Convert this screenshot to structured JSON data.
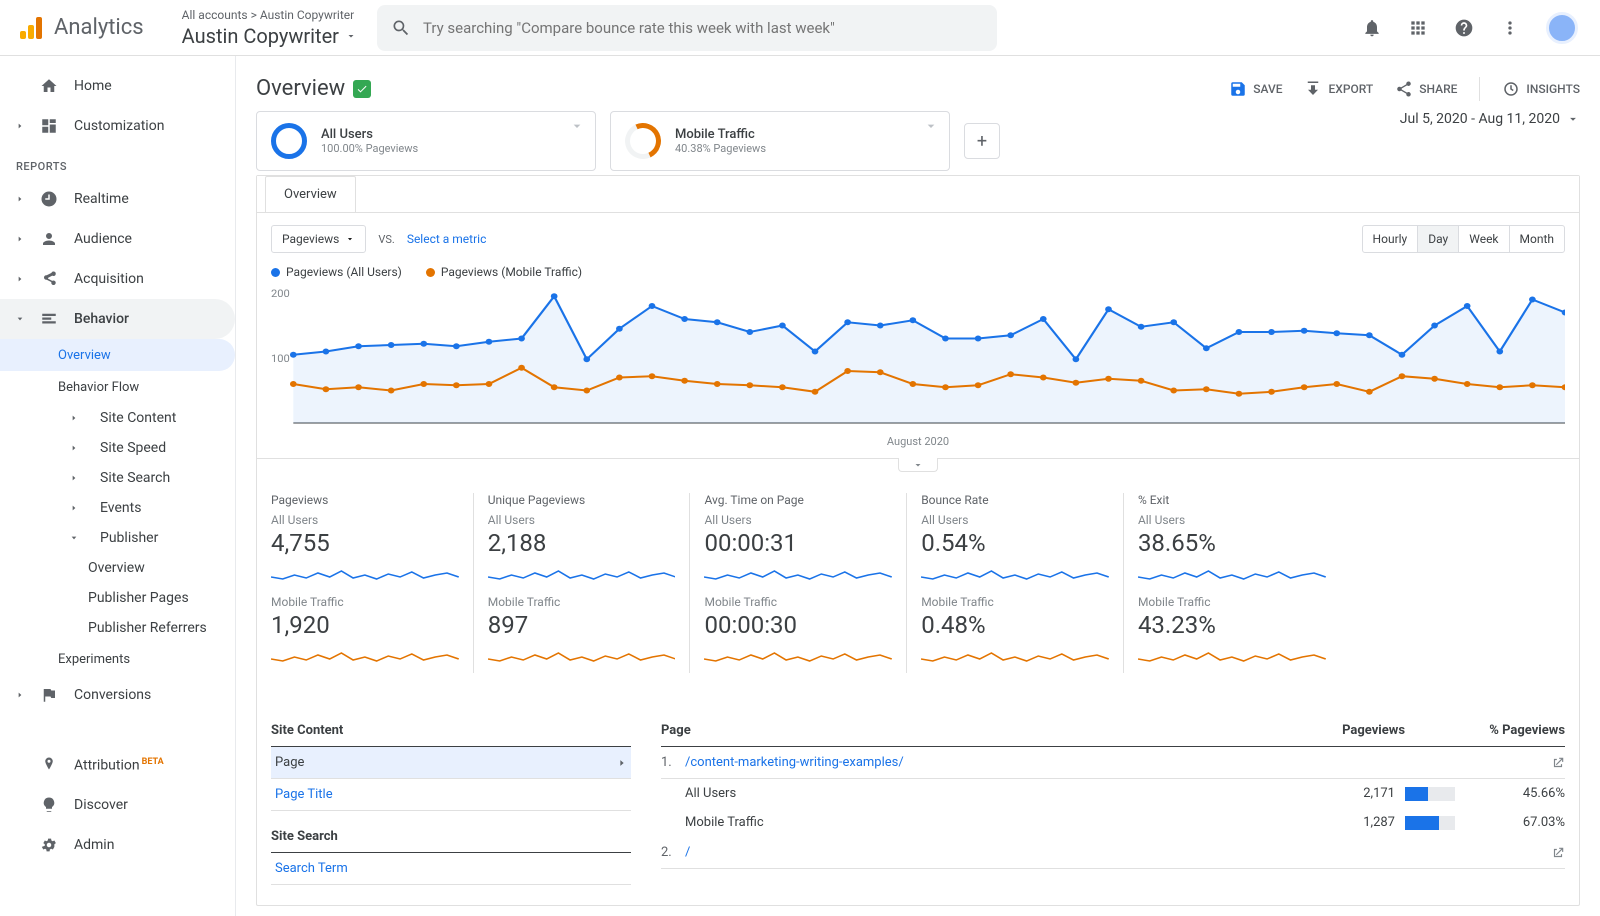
{
  "appbar": {
    "logo_text": "Analytics",
    "breadcrumb_top": "All accounts > Austin Copywriter",
    "breadcrumb_main": "Austin Copywriter",
    "search_placeholder": "Try searching \"Compare bounce rate this week with last week\""
  },
  "sidebar": {
    "home": "Home",
    "customization": "Customization",
    "reports_heading": "REPORTS",
    "realtime": "Realtime",
    "audience": "Audience",
    "acquisition": "Acquisition",
    "behavior": "Behavior",
    "b_overview": "Overview",
    "b_flow": "Behavior Flow",
    "b_sitecontent": "Site Content",
    "b_sitespeed": "Site Speed",
    "b_sitesearch": "Site Search",
    "b_events": "Events",
    "b_publisher": "Publisher",
    "b_pub_overview": "Overview",
    "b_pub_pages": "Publisher Pages",
    "b_pub_refs": "Publisher Referrers",
    "b_experiments": "Experiments",
    "conversions": "Conversions",
    "attribution": "Attribution",
    "beta": "BETA",
    "discover": "Discover",
    "admin": "Admin"
  },
  "page": {
    "title": "Overview",
    "save": "SAVE",
    "export": "EXPORT",
    "share": "SHARE",
    "insights": "INSIGHTS",
    "date_range": "Jul 5, 2020 - Aug 11, 2020"
  },
  "segments": {
    "a": {
      "title": "All Users",
      "sub": "100.00% Pageviews"
    },
    "b": {
      "title": "Mobile Traffic",
      "sub": "40.38% Pageviews"
    }
  },
  "tabs": {
    "overview": "Overview"
  },
  "chartbar": {
    "metric": "Pageviews",
    "vs": "VS.",
    "select_metric": "Select a metric",
    "hourly": "Hourly",
    "day": "Day",
    "week": "Week",
    "month": "Month"
  },
  "legend": {
    "a": "Pageviews (All Users)",
    "b": "Pageviews (Mobile Traffic)"
  },
  "chart_data": {
    "type": "line",
    "ylim": [
      0,
      200
    ],
    "yticks": [
      100,
      200
    ],
    "xlabel": "August 2020",
    "series": [
      {
        "name": "Pageviews (All Users)",
        "color": "#1a73e8",
        "values": [
          105,
          110,
          118,
          120,
          122,
          118,
          125,
          130,
          195,
          98,
          145,
          180,
          160,
          155,
          140,
          150,
          110,
          155,
          150,
          158,
          130,
          130,
          135,
          160,
          98,
          175,
          148,
          155,
          115,
          140,
          140,
          142,
          138,
          135,
          105,
          150,
          180,
          110,
          190,
          170
        ]
      },
      {
        "name": "Pageviews (Mobile Traffic)",
        "color": "#e37400",
        "values": [
          60,
          52,
          55,
          50,
          60,
          58,
          60,
          85,
          55,
          50,
          70,
          72,
          65,
          60,
          58,
          55,
          48,
          80,
          78,
          60,
          55,
          58,
          75,
          70,
          62,
          68,
          65,
          50,
          52,
          45,
          48,
          55,
          60,
          48,
          72,
          68,
          60,
          55,
          58,
          55
        ]
      }
    ]
  },
  "metrics": [
    {
      "label": "Pageviews",
      "a_sub": "All Users",
      "a_val": "4,755",
      "b_sub": "Mobile Traffic",
      "b_val": "1,920"
    },
    {
      "label": "Unique Pageviews",
      "a_sub": "All Users",
      "a_val": "2,188",
      "b_sub": "Mobile Traffic",
      "b_val": "897"
    },
    {
      "label": "Avg. Time on Page",
      "a_sub": "All Users",
      "a_val": "00:00:31",
      "b_sub": "Mobile Traffic",
      "b_val": "00:00:30"
    },
    {
      "label": "Bounce Rate",
      "a_sub": "All Users",
      "a_val": "0.54%",
      "b_sub": "Mobile Traffic",
      "b_val": "0.48%"
    },
    {
      "label": "% Exit",
      "a_sub": "All Users",
      "a_val": "38.65%",
      "b_sub": "Mobile Traffic",
      "b_val": "43.23%"
    }
  ],
  "left_table": {
    "h1": "Site Content",
    "r1": "Page",
    "r2": "Page Title",
    "h2": "Site Search",
    "r3": "Search Term"
  },
  "right_table": {
    "h_page": "Page",
    "h_pv": "Pageviews",
    "h_pct": "% Pageviews",
    "rows": [
      {
        "n": "1.",
        "link": "/content-marketing-writing-examples/",
        "a_lab": "All Users",
        "a_v": "2,171",
        "a_pct": "45.66%",
        "a_bar": 45.66,
        "b_lab": "Mobile Traffic",
        "b_v": "1,287",
        "b_pct": "67.03%",
        "b_bar": 67.03
      },
      {
        "n": "2.",
        "link": "/"
      }
    ]
  }
}
